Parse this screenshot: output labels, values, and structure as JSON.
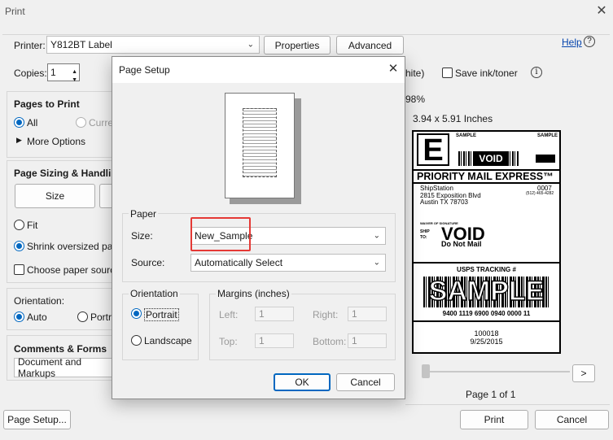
{
  "window": {
    "title": "Print",
    "close_icon": "close-icon"
  },
  "printer": {
    "label": "Printer:",
    "value": "Y812BT Label",
    "properties": "Properties",
    "advanced": "Advanced"
  },
  "help": {
    "label": "Help"
  },
  "copies": {
    "label": "Copies:",
    "value": "1"
  },
  "grayscale_partial": "hite)",
  "save_ink": "Save ink/toner",
  "pages_to_print": {
    "title": "Pages to Print",
    "all": "All",
    "current": "Curre",
    "more_options": "More Options"
  },
  "sizing": {
    "title": "Page Sizing & Handling",
    "size_tab": "Size",
    "fit": "Fit",
    "shrink": "Shrink oversized page",
    "choose_source": "Choose paper source"
  },
  "orientation": {
    "title": "Orientation:",
    "auto": "Auto",
    "portrait": "Portr"
  },
  "comments": {
    "title": "Comments & Forms",
    "value": "Document and Markups"
  },
  "bottom": {
    "page_setup": "Page Setup...",
    "print": "Print",
    "cancel": "Cancel"
  },
  "preview": {
    "scale": "98%",
    "dimensions": "3.94 x 5.91 Inches",
    "page_indicator": "Page 1 of 1",
    "next": ">"
  },
  "shipping_label": {
    "service_letter": "E",
    "sample_tl": "SAMPLE",
    "void_badge": "VOID",
    "sample_tr": "SAMPLE",
    "title": "PRIORITY MAIL EXPRESS™",
    "sender_name": "ShipStation",
    "sender_street": "2815 Exposition Blvd",
    "sender_city": "Austin TX 78703",
    "code": "0007",
    "phone": "(512) 465-4282",
    "waiver": "WAIVER OF SIGNATURE",
    "ship_to_label": "SHIP TO:",
    "void_big": "VOID",
    "do_not_mail": "Do Not Mail",
    "tracking_label": "USPS TRACKING #",
    "sample_big": "SAMPLE",
    "tracking_number": "9400 1119 6900 0940 0000 11",
    "ref_number": "100018",
    "ref_date": "9/25/2015"
  },
  "dialog": {
    "title": "Page Setup",
    "paper_group": "Paper",
    "size_label": "Size:",
    "size_value": "New_Sample",
    "source_label": "Source:",
    "source_value": "Automatically Select",
    "orientation_group": "Orientation",
    "portrait": "Portrait",
    "landscape": "Landscape",
    "margins_group": "Margins (inches)",
    "left_label": "Left:",
    "left_value": "1",
    "right_label": "Right:",
    "right_value": "1",
    "top_label": "Top:",
    "top_value": "1",
    "bottom_label": "Bottom:",
    "bottom_value": "1",
    "ok": "OK",
    "cancel": "Cancel",
    "highlight_color": "#e53935"
  }
}
